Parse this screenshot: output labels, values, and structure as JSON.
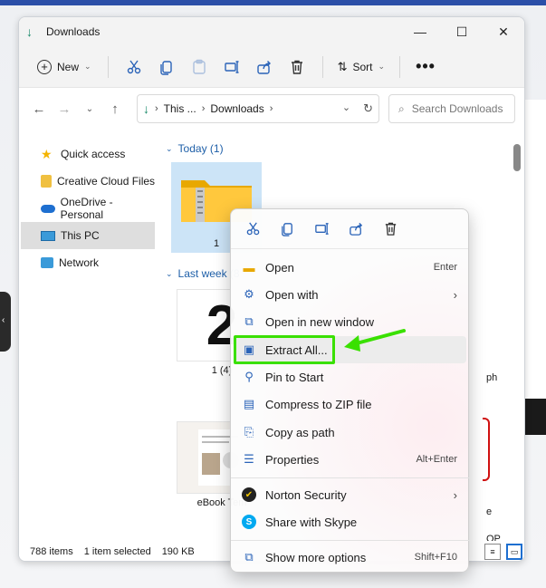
{
  "window": {
    "title": "Downloads",
    "controls": {
      "minimize": "—",
      "maximize": "☐",
      "close": "✕"
    }
  },
  "commandbar": {
    "new_label": "New",
    "sort_label": "Sort",
    "more": "•••"
  },
  "address": {
    "crumbs": [
      "This ...",
      "Downloads"
    ],
    "search_placeholder": "Search Downloads"
  },
  "sidebar": {
    "items": [
      {
        "label": "Quick access",
        "icon": "star-icon"
      },
      {
        "label": "Creative Cloud Files",
        "icon": "creative-cloud-icon"
      },
      {
        "label": "OneDrive - Personal",
        "icon": "cloud-icon"
      },
      {
        "label": "This PC",
        "icon": "monitor-icon"
      },
      {
        "label": "Network",
        "icon": "network-icon"
      }
    ]
  },
  "content": {
    "group_today": "Today (1)",
    "group_lastweek": "Last week (8",
    "tiles": [
      {
        "caption": "1"
      },
      {
        "caption": "1 (4)",
        "glyph": "2"
      },
      {
        "caption": "eBook Tem"
      }
    ],
    "partial_captions": [
      "ph",
      "e",
      "OP"
    ]
  },
  "status": {
    "items": "788 items",
    "selected": "1 item selected",
    "size": "190 KB"
  },
  "context_menu": {
    "items": [
      {
        "label": "Open",
        "shortcut": "Enter",
        "icon": "folder-icon"
      },
      {
        "label": "Open with",
        "shortcut": "",
        "icon": "open-with-icon",
        "submenu": true
      },
      {
        "label": "Open in new window",
        "shortcut": "",
        "icon": "new-window-icon"
      },
      {
        "label": "Extract All...",
        "shortcut": "",
        "icon": "extract-icon"
      },
      {
        "label": "Pin to Start",
        "shortcut": "",
        "icon": "pin-icon"
      },
      {
        "label": "Compress to ZIP file",
        "shortcut": "",
        "icon": "zip-icon"
      },
      {
        "label": "Copy as path",
        "shortcut": "",
        "icon": "copy-path-icon"
      },
      {
        "label": "Properties",
        "shortcut": "Alt+Enter",
        "icon": "properties-icon"
      },
      {
        "label": "Norton Security",
        "shortcut": "",
        "icon": "norton-icon",
        "submenu": true
      },
      {
        "label": "Share with Skype",
        "shortcut": "",
        "icon": "skype-icon"
      },
      {
        "label": "Show more options",
        "shortcut": "Shift+F10",
        "icon": "more-options-icon"
      }
    ]
  },
  "colors": {
    "accent": "#2a63b8",
    "highlight": "#3ae000",
    "selection": "#cce4f7"
  }
}
